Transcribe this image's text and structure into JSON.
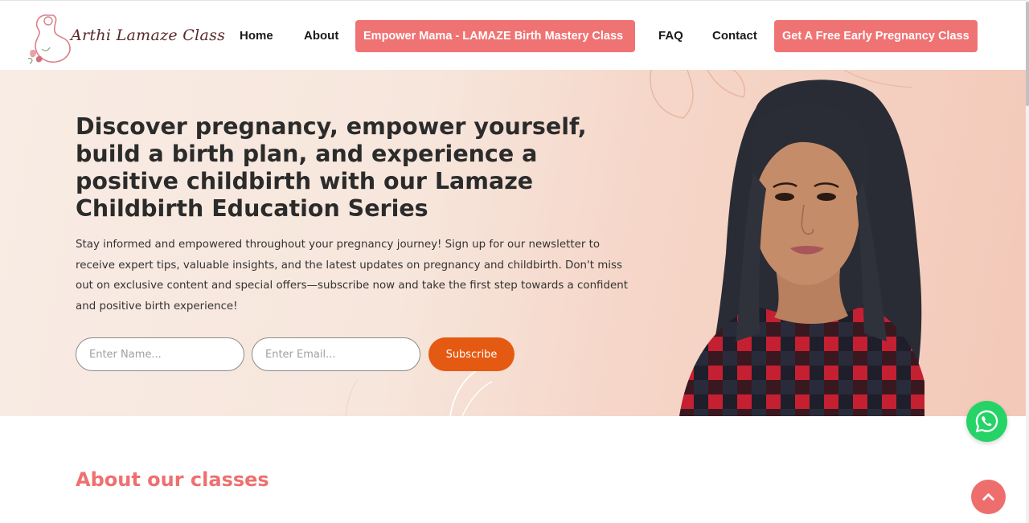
{
  "logo": {
    "text": "Arthi Lamaze Class"
  },
  "nav": {
    "home": "Home",
    "about": "About",
    "empower": "Empower Mama - LAMAZE Birth Mastery Class",
    "faq": "FAQ",
    "contact": "Contact",
    "free_class": "Get A Free Early Pregnancy Class"
  },
  "hero": {
    "title": "Discover pregnancy, empower yourself, build a birth plan, and experience a positive childbirth with our Lamaze Childbirth Education Series",
    "description": "Stay informed and empowered throughout your pregnancy journey! Sign up for our newsletter to receive expert tips, valuable insights, and the latest updates on pregnancy and childbirth. Don't miss out on exclusive content and special offers—subscribe now and take the first step towards a confident and positive birth experience!",
    "name_placeholder": "Enter Name...",
    "email_placeholder": "Enter Email...",
    "subscribe_label": "Subscribe"
  },
  "about": {
    "title": "About our classes"
  },
  "icons": {
    "whatsapp": "whatsapp-icon",
    "scroll_top": "chevron-up-icon",
    "logo": "pregnant-mother-logo-icon"
  },
  "colors": {
    "accent": "#f07373",
    "subscribe": "#e55a12",
    "whatsapp": "#25d366",
    "heading": "#ee7070"
  }
}
